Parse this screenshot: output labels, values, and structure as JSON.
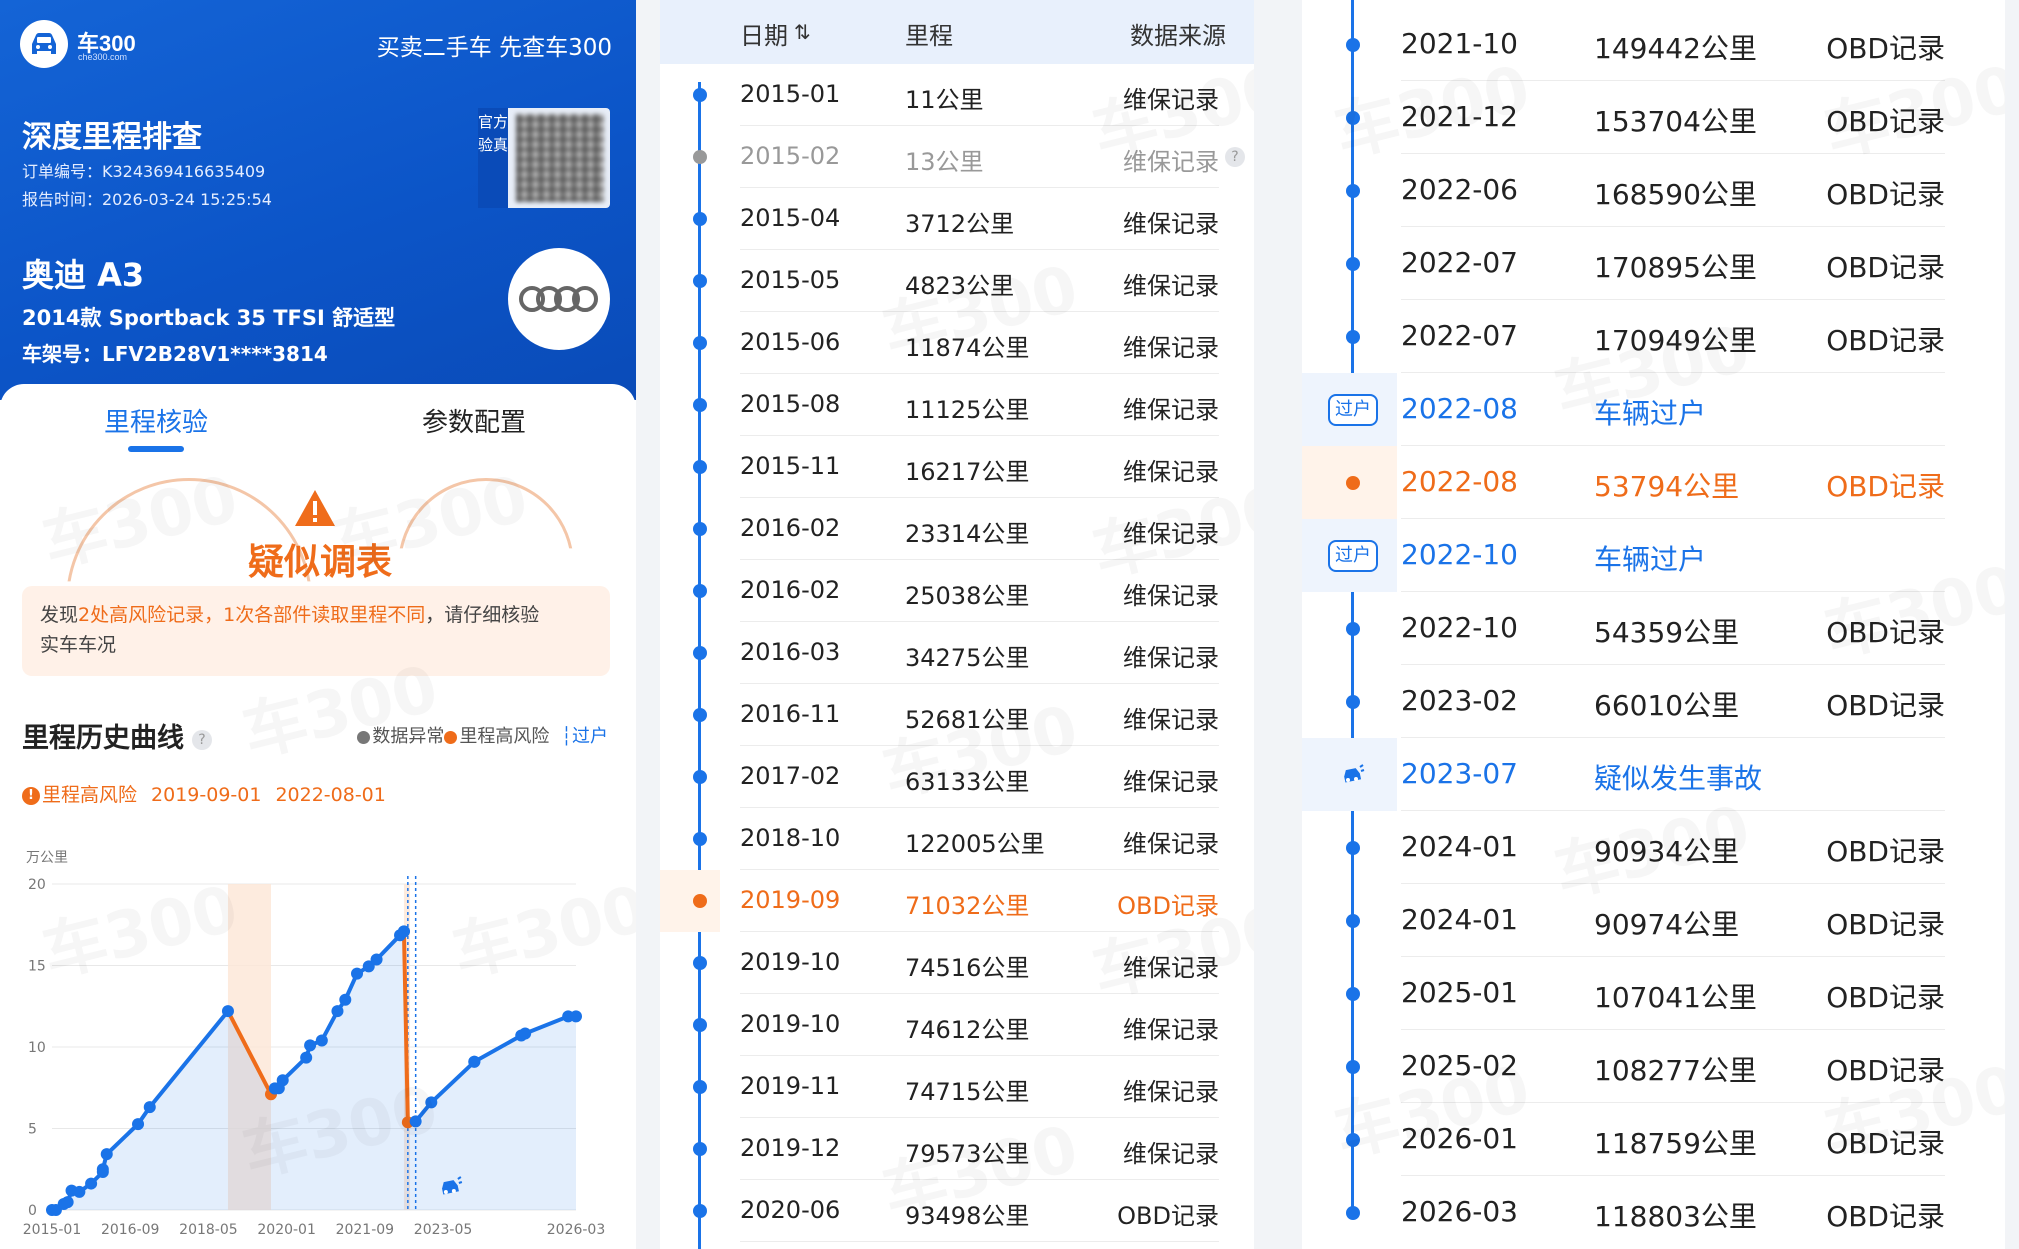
{
  "header": {
    "logo_text": "车300",
    "logo_sub": "che300.com",
    "slogan": "买卖二手车 先查车300",
    "report_title": "深度里程排查",
    "order_no": "订单编号：K324369416635409",
    "report_time": "报告时间：2026-03-24 15:25:54",
    "official_label": "官方验真",
    "car_name": "奥迪 A3",
    "car_model": "2014款 Sportback 35 TFSI 舒适型",
    "vin": "车架号：LFV2B28V1****3814"
  },
  "tabs": [
    {
      "label": "里程核验",
      "active": true
    },
    {
      "label": "参数配置",
      "active": false
    }
  ],
  "verdict": {
    "label": "疑似调表",
    "alert_prefix": "发现",
    "alert_highlight": "2处高风险记录，1次各部件读取里程不同",
    "alert_suffix": "，请仔细核验",
    "alert_line2": "实车车况"
  },
  "history": {
    "title": "里程历史曲线",
    "help": "?",
    "legend": {
      "abnormal": "数据异常",
      "high_risk": "里程高风险",
      "transfer": "过户"
    },
    "risk_label": "里程高风险",
    "risk_dates": [
      "2019-09-01",
      "2022-08-01"
    ]
  },
  "colors": {
    "accent": "#1a73e8",
    "risk": "#ef6c1a",
    "header_bg": "#0c55c8",
    "muted": "#999999"
  },
  "chart_data": {
    "type": "line",
    "ylabel": "万公里",
    "ylim": [
      0,
      20
    ],
    "yticks": [
      "0",
      "5",
      "10",
      "15",
      "20"
    ],
    "xticks": [
      "2015-01",
      "2016-09",
      "2018-05",
      "2020-01",
      "2021-09",
      "2023-05",
      "2026-03"
    ],
    "x_range": [
      "2015-01",
      "2026-03"
    ],
    "series": [
      {
        "points": [
          {
            "x": "2015-01",
            "y": 0.0011
          },
          {
            "x": "2015-02",
            "y": 0.0013
          },
          {
            "x": "2015-04",
            "y": 0.3712
          },
          {
            "x": "2015-05",
            "y": 0.4823
          },
          {
            "x": "2015-06",
            "y": 1.1874
          },
          {
            "x": "2015-08",
            "y": 1.1125
          },
          {
            "x": "2015-11",
            "y": 1.6217
          },
          {
            "x": "2016-02",
            "y": 2.3314
          },
          {
            "x": "2016-02",
            "y": 2.5038
          },
          {
            "x": "2016-03",
            "y": 3.4275
          },
          {
            "x": "2016-11",
            "y": 5.2681
          },
          {
            "x": "2017-02",
            "y": 6.3133
          },
          {
            "x": "2018-10",
            "y": 12.2005
          },
          {
            "x": "2019-09",
            "y": 7.1032
          },
          {
            "x": "2019-10",
            "y": 7.4516
          },
          {
            "x": "2019-10",
            "y": 7.4612
          },
          {
            "x": "2019-11",
            "y": 7.4715
          },
          {
            "x": "2019-12",
            "y": 7.9573
          },
          {
            "x": "2020-06",
            "y": 9.3498
          },
          {
            "x": "2020-07",
            "y": 10.1
          },
          {
            "x": "2020-10",
            "y": 10.4
          },
          {
            "x": "2021-02",
            "y": 12.2
          },
          {
            "x": "2021-04",
            "y": 12.9
          },
          {
            "x": "2021-07",
            "y": 14.5
          },
          {
            "x": "2021-10",
            "y": 14.9442
          },
          {
            "x": "2021-12",
            "y": 15.3704
          },
          {
            "x": "2022-06",
            "y": 16.859
          },
          {
            "x": "2022-07",
            "y": 17.0895
          },
          {
            "x": "2022-07",
            "y": 17.0949
          },
          {
            "x": "2022-08",
            "y": 5.3794
          },
          {
            "x": "2022-10",
            "y": 5.4359
          },
          {
            "x": "2023-02",
            "y": 6.601
          },
          {
            "x": "2024-01",
            "y": 9.0934
          },
          {
            "x": "2024-01",
            "y": 9.0974
          },
          {
            "x": "2025-01",
            "y": 10.7041
          },
          {
            "x": "2025-02",
            "y": 10.8277
          },
          {
            "x": "2026-01",
            "y": 11.8759
          },
          {
            "x": "2026-03",
            "y": 11.8803
          }
        ]
      }
    ],
    "risk_segments": [
      [
        "2018-10",
        "2019-09"
      ],
      [
        "2022-07",
        "2022-08"
      ]
    ],
    "transfer_markers": [
      "2022-08",
      "2022-10"
    ],
    "accident_marker": "2023-07",
    "grid": true
  },
  "table": {
    "headers": {
      "date": "日期",
      "sort": "⇅",
      "mileage": "里程",
      "source": "数据来源"
    },
    "rows": [
      {
        "date": "2015-01",
        "mileage": "11公里",
        "source": "维保记录",
        "status": "normal"
      },
      {
        "date": "2015-02",
        "mileage": "13公里",
        "source": "维保记录",
        "status": "abnormal",
        "help": "?"
      },
      {
        "date": "2015-04",
        "mileage": "3712公里",
        "source": "维保记录",
        "status": "normal"
      },
      {
        "date": "2015-05",
        "mileage": "4823公里",
        "source": "维保记录",
        "status": "normal"
      },
      {
        "date": "2015-06",
        "mileage": "11874公里",
        "source": "维保记录",
        "status": "normal"
      },
      {
        "date": "2015-08",
        "mileage": "11125公里",
        "source": "维保记录",
        "status": "normal"
      },
      {
        "date": "2015-11",
        "mileage": "16217公里",
        "source": "维保记录",
        "status": "normal"
      },
      {
        "date": "2016-02",
        "mileage": "23314公里",
        "source": "维保记录",
        "status": "normal"
      },
      {
        "date": "2016-02",
        "mileage": "25038公里",
        "source": "维保记录",
        "status": "normal"
      },
      {
        "date": "2016-03",
        "mileage": "34275公里",
        "source": "维保记录",
        "status": "normal"
      },
      {
        "date": "2016-11",
        "mileage": "52681公里",
        "source": "维保记录",
        "status": "normal"
      },
      {
        "date": "2017-02",
        "mileage": "63133公里",
        "source": "维保记录",
        "status": "normal"
      },
      {
        "date": "2018-10",
        "mileage": "122005公里",
        "source": "维保记录",
        "status": "normal"
      },
      {
        "date": "2019-09",
        "mileage": "71032公里",
        "source": "OBD记录",
        "status": "risk"
      },
      {
        "date": "2019-10",
        "mileage": "74516公里",
        "source": "维保记录",
        "status": "normal"
      },
      {
        "date": "2019-10",
        "mileage": "74612公里",
        "source": "维保记录",
        "status": "normal"
      },
      {
        "date": "2019-11",
        "mileage": "74715公里",
        "source": "维保记录",
        "status": "normal"
      },
      {
        "date": "2019-12",
        "mileage": "79573公里",
        "source": "维保记录",
        "status": "normal"
      },
      {
        "date": "2020-06",
        "mileage": "93498公里",
        "source": "OBD记录",
        "status": "normal"
      }
    ]
  },
  "timeline": {
    "rows": [
      {
        "date": "2021-10",
        "mileage": "149442公里",
        "source": "OBD记录",
        "status": "normal"
      },
      {
        "date": "2021-12",
        "mileage": "153704公里",
        "source": "OBD记录",
        "status": "normal"
      },
      {
        "date": "2022-06",
        "mileage": "168590公里",
        "source": "OBD记录",
        "status": "normal"
      },
      {
        "date": "2022-07",
        "mileage": "170895公里",
        "source": "OBD记录",
        "status": "normal"
      },
      {
        "date": "2022-07",
        "mileage": "170949公里",
        "source": "OBD记录",
        "status": "normal"
      },
      {
        "date": "2022-08",
        "mileage": "车辆过户",
        "source": "",
        "status": "transfer",
        "tag": "过户"
      },
      {
        "date": "2022-08",
        "mileage": "53794公里",
        "source": "OBD记录",
        "status": "risk"
      },
      {
        "date": "2022-10",
        "mileage": "车辆过户",
        "source": "",
        "status": "transfer",
        "tag": "过户"
      },
      {
        "date": "2022-10",
        "mileage": "54359公里",
        "source": "OBD记录",
        "status": "normal"
      },
      {
        "date": "2023-02",
        "mileage": "66010公里",
        "source": "OBD记录",
        "status": "normal"
      },
      {
        "date": "2023-07",
        "mileage": "疑似发生事故",
        "source": "",
        "status": "accident"
      },
      {
        "date": "2024-01",
        "mileage": "90934公里",
        "source": "OBD记录",
        "status": "normal"
      },
      {
        "date": "2024-01",
        "mileage": "90974公里",
        "source": "OBD记录",
        "status": "normal"
      },
      {
        "date": "2025-01",
        "mileage": "107041公里",
        "source": "OBD记录",
        "status": "normal"
      },
      {
        "date": "2025-02",
        "mileage": "108277公里",
        "source": "OBD记录",
        "status": "normal"
      },
      {
        "date": "2026-01",
        "mileage": "118759公里",
        "source": "OBD记录",
        "status": "normal"
      },
      {
        "date": "2026-03",
        "mileage": "118803公里",
        "source": "OBD记录",
        "status": "normal"
      }
    ]
  },
  "watermark": "车300"
}
